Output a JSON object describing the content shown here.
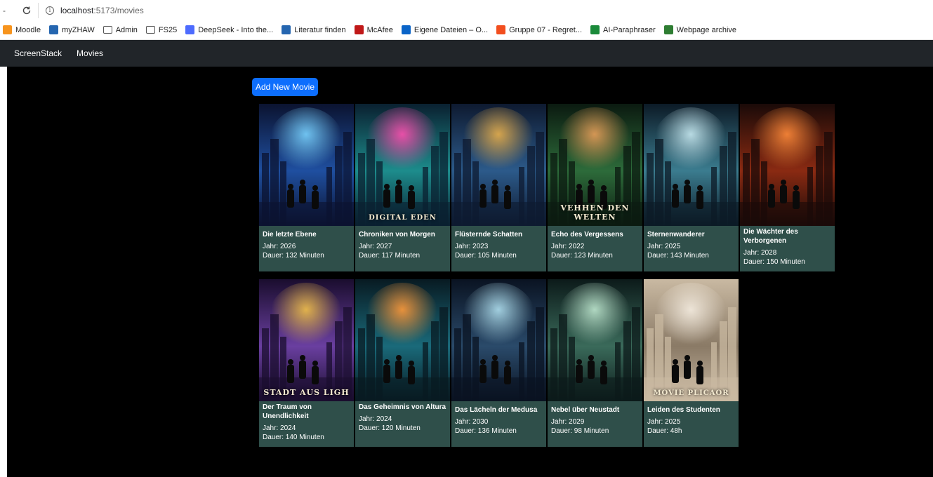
{
  "browser": {
    "url_host": "localhost",
    "url_path": ":5173/movies",
    "bookmarks": [
      {
        "label": "Moodle",
        "icon": "moodle-icon",
        "color": "#f7941d"
      },
      {
        "label": "myZHAW",
        "icon": "myzhaw-icon",
        "color": "#2566b0"
      },
      {
        "label": "Admin",
        "icon": "folder-icon",
        "color": "#555555"
      },
      {
        "label": "FS25",
        "icon": "folder-icon",
        "color": "#555555"
      },
      {
        "label": "DeepSeek - Into the...",
        "icon": "deepseek-icon",
        "color": "#4d6bfe"
      },
      {
        "label": "Literatur finden",
        "icon": "literatur-icon",
        "color": "#2566b0"
      },
      {
        "label": "McAfee",
        "icon": "mcafee-icon",
        "color": "#c01818"
      },
      {
        "label": "Eigene Dateien – O...",
        "icon": "onedrive-icon",
        "color": "#0a64c8"
      },
      {
        "label": "Gruppe 07 - Regret...",
        "icon": "figma-icon",
        "color": "#f24e1e"
      },
      {
        "label": "AI-Paraphraser",
        "icon": "paraphraser-icon",
        "color": "#1a8a3a"
      },
      {
        "label": "Webpage archive",
        "icon": "archive-icon",
        "color": "#2e7d32"
      }
    ]
  },
  "navbar": {
    "brand": "ScreenStack",
    "link_movies": "Movies"
  },
  "toolbar": {
    "add_label": "Add New Movie"
  },
  "movies": [
    {
      "title": "Die letzte Ebene",
      "year": "Jahr: 2026",
      "duration": "Dauer: 132 Minuten",
      "poster_text": "",
      "palette": [
        "#0b1330",
        "#1f4fa0",
        "#79d2ff"
      ]
    },
    {
      "title": "Chroniken von Morgen",
      "year": "Jahr: 2027",
      "duration": "Dauer: 117 Minuten",
      "poster_text": "DIGITAL EDEN",
      "palette": [
        "#0a2030",
        "#1d8c8c",
        "#ff4fb0"
      ]
    },
    {
      "title": "Flüsternde Schatten",
      "year": "Jahr: 2023",
      "duration": "Dauer: 105 Minuten",
      "poster_text": "",
      "palette": [
        "#0e1a30",
        "#2c5a8a",
        "#e9b04c"
      ]
    },
    {
      "title": "Echo des Vergessens",
      "year": "Jahr: 2022",
      "duration": "Dauer: 123 Minuten",
      "poster_text": "VEHHEN DEN WELTEN",
      "palette": [
        "#0b1a10",
        "#2d6b3a",
        "#e8a05a"
      ]
    },
    {
      "title": "Sternenwanderer",
      "year": "Jahr: 2025",
      "duration": "Dauer: 143 Minuten",
      "poster_text": "",
      "palette": [
        "#0c1a26",
        "#3b7c8f",
        "#c8eaf2"
      ]
    },
    {
      "title": "Die Wächter des Verborgenen",
      "year": "Jahr: 2028",
      "duration": "Dauer: 150 Minuten",
      "poster_text": "",
      "palette": [
        "#1a0a08",
        "#8a2a12",
        "#ff8a3a"
      ]
    },
    {
      "title": "Der Traum von Unendlichkeit",
      "year": "Jahr: 2024",
      "duration": "Dauer: 140 Minuten",
      "poster_text": "STADT AUS LIGH",
      "palette": [
        "#1a0d2e",
        "#6a3fa0",
        "#f2c14a"
      ]
    },
    {
      "title": "Das Geheimnis von Altura",
      "year": "Jahr: 2024",
      "duration": "Dauer: 120 Minuten",
      "poster_text": "",
      "palette": [
        "#081a22",
        "#1a6a7a",
        "#ff9a3a"
      ]
    },
    {
      "title": "Das Lächeln der Medusa",
      "year": "Jahr: 2030",
      "duration": "Dauer: 136 Minuten",
      "poster_text": "",
      "palette": [
        "#0a1322",
        "#2a4a6a",
        "#b0e0f0"
      ]
    },
    {
      "title": "Nebel über Neustadt",
      "year": "Jahr: 2029",
      "duration": "Dauer: 98 Minuten",
      "poster_text": "",
      "palette": [
        "#0c1a1a",
        "#3a6a5a",
        "#bfe8d0"
      ]
    },
    {
      "title": "Leiden des Studenten",
      "year": "Jahr: 2025",
      "duration": "Dauer: 48h",
      "poster_text": "MOVIE PLICAOR",
      "palette": [
        "#c9b9a2",
        "#8a7a66",
        "#f4ece0"
      ]
    }
  ]
}
